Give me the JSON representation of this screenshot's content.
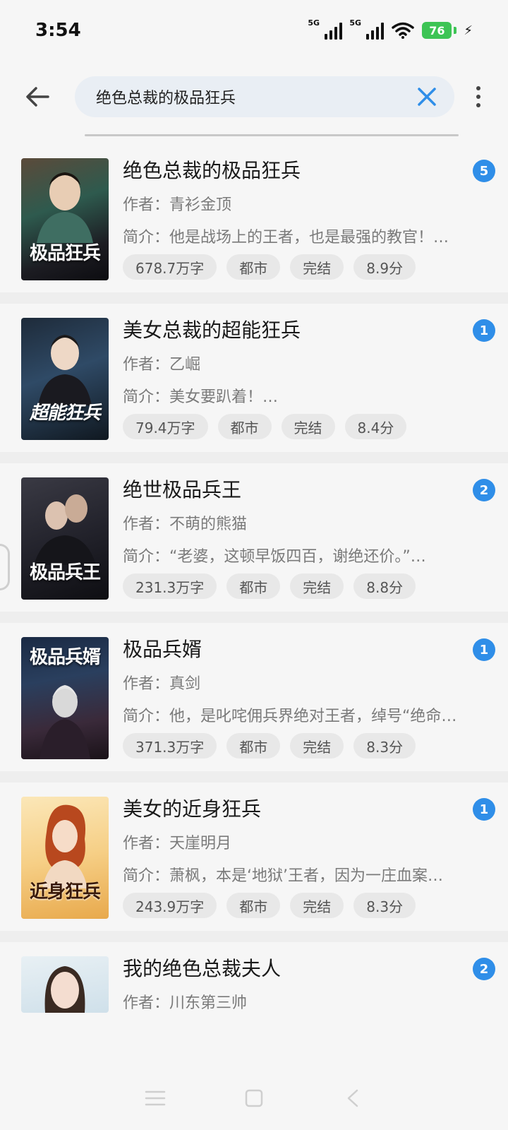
{
  "status_bar": {
    "time": "3:54",
    "signal1_label": "5G",
    "signal2_label": "5G",
    "battery": "76",
    "icons": [
      "signal-icon",
      "wifi-icon",
      "battery-icon",
      "charging-icon"
    ]
  },
  "search": {
    "query": "绝色总裁的极品狂兵"
  },
  "colors": {
    "accent": "#2f8ee8",
    "battery": "#3dc455"
  },
  "results": [
    {
      "title": "绝色总裁的极品狂兵",
      "author": "作者：青衫金顶",
      "intro": "简介：他是战场上的王者，也是最强的教官！…",
      "tags": [
        "678.7万字",
        "都市",
        "完结",
        "8.9分"
      ],
      "badge": "5",
      "cover_title": "极品狂兵"
    },
    {
      "title": "美女总裁的超能狂兵",
      "author": "作者：乙崛",
      "intro": "简介：美女要趴着！…",
      "tags": [
        "79.4万字",
        "都市",
        "完结",
        "8.4分"
      ],
      "badge": "1",
      "cover_title": "超能狂兵"
    },
    {
      "title": "绝世极品兵王",
      "author": "作者：不萌的熊猫",
      "intro": "简介：“老婆，这顿早饭四百，谢绝还价。”…",
      "tags": [
        "231.3万字",
        "都市",
        "完结",
        "8.8分"
      ],
      "badge": "2",
      "cover_title": "极品兵王"
    },
    {
      "title": "极品兵婿",
      "author": "作者：真剑",
      "intro": "简介：他，是叱咤佣兵界绝对王者，绰号“绝命…",
      "tags": [
        "371.3万字",
        "都市",
        "完结",
        "8.3分"
      ],
      "badge": "1",
      "cover_title": "极品兵婿"
    },
    {
      "title": "美女的近身狂兵",
      "author": "作者：天崖明月",
      "intro": "简介：萧枫，本是‘地狱’王者，因为一庄血案…",
      "tags": [
        "243.9万字",
        "都市",
        "完结",
        "8.3分"
      ],
      "badge": "1",
      "cover_title": "近身狂兵"
    },
    {
      "title": "我的绝色总裁夫人",
      "author": "作者：川东第三帅",
      "intro": "",
      "tags": [],
      "badge": "2",
      "cover_title": ""
    }
  ]
}
